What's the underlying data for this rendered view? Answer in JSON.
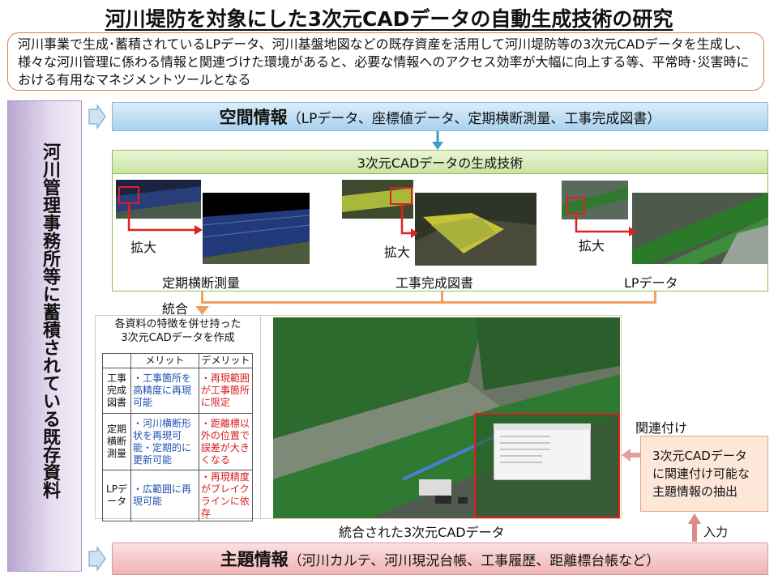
{
  "title": "河川堤防を対象にした3次元CADデータの自動生成技術の研究",
  "intro": "河川事業で生成･蓄積されているLPデータ、河川基盤地図などの既存資産を活用して河川堤防等の3次元CADデータを生成し、様々な河川管理に係わる情報と関連づけた環境があると、必要な情報へのアクセス効率が大幅に向上する等、平常時･災害時における有用なマネジメントツールとなる",
  "sidebar": "河川管理事務所等に蓄積されている既存資料",
  "spatial": {
    "bold": "空間情報",
    "rest": "（LPデータ、座標値データ、定期横断測量、工事完成図書）"
  },
  "generation": {
    "header": "3次元CADデータの生成技術",
    "zoom": "拡大",
    "items": [
      "定期横断測量",
      "工事完成図書",
      "LPデータ"
    ]
  },
  "integrate": "統合",
  "table": {
    "caption1": "各資料の特徴を併せ持った",
    "caption2": "3次元CADデータを作成",
    "head_merit": "メリット",
    "head_demerit": "デメリット",
    "rows": [
      {
        "name": "工事完成図書",
        "merit": "・工事箇所を高精度に再現可能",
        "demerit": "・再現範囲が工事箇所に限定"
      },
      {
        "name": "定期横断測量",
        "merit": "・河川横断形状を再現可能・定期的に更新可能",
        "demerit": "・距離標以外の位置で誤差が大きくなる"
      },
      {
        "name": "LPデータ",
        "merit": "・広範囲に再現可能",
        "demerit": "・再現精度がブレイクラインに依存"
      }
    ]
  },
  "integrated_label": "統合された3次元CADデータ",
  "link_label": "関連付け",
  "extraction": "3次元CADデータに関連付け可能な主題情報の抽出",
  "input_label": "入力",
  "thematic": {
    "bold": "主題情報",
    "rest": "（河川カルテ、河川現況台帳、工事履歴、距離標台帳など）"
  },
  "colors": {
    "spatial": "#a9d2ee",
    "generation": "#c9e4a2",
    "thematic": "#f0b4b4",
    "sidebar": "#b8a6cf",
    "accent_red": "#e02020",
    "connector_orange": "#f0a060"
  }
}
